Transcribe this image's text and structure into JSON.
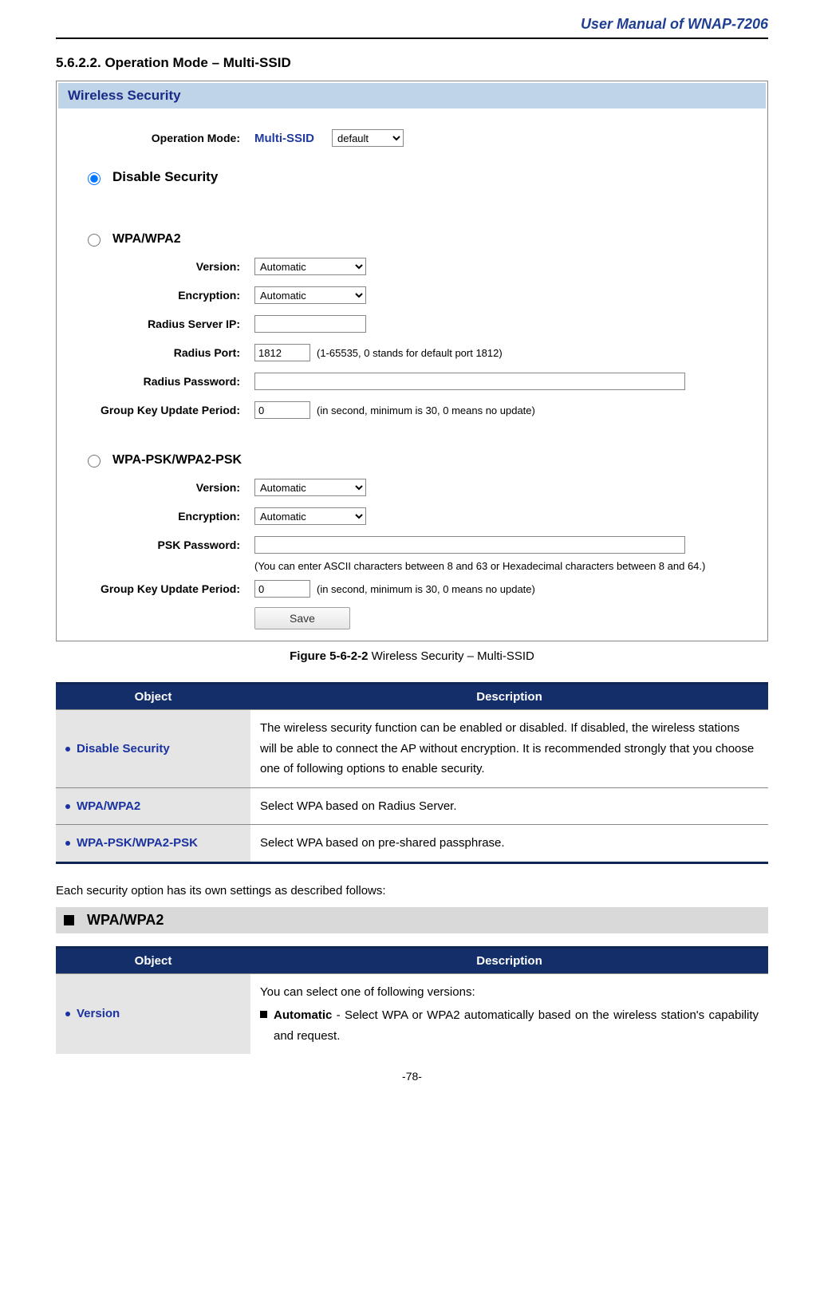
{
  "header": {
    "title": "User Manual of WNAP-7206"
  },
  "section": {
    "number": "5.6.2.2.",
    "title": "Operation Mode – Multi-SSID"
  },
  "panel": {
    "title": "Wireless Security",
    "operationMode": {
      "label": "Operation Mode:",
      "value": "Multi-SSID",
      "select": "default"
    },
    "disable": {
      "title": "Disable Security"
    },
    "wpa": {
      "title": "WPA/WPA2",
      "version": {
        "label": "Version:",
        "value": "Automatic"
      },
      "encryption": {
        "label": "Encryption:",
        "value": "Automatic"
      },
      "radiusIp": {
        "label": "Radius Server IP:",
        "value": ""
      },
      "radiusPort": {
        "label": "Radius Port:",
        "value": "1812",
        "hint": "(1-65535, 0 stands for default port 1812)"
      },
      "radiusPwd": {
        "label": "Radius Password:",
        "value": ""
      },
      "groupKey": {
        "label": "Group Key Update Period:",
        "value": "0",
        "hint": "(in second, minimum is 30, 0 means no update)"
      }
    },
    "psk": {
      "title": "WPA-PSK/WPA2-PSK",
      "version": {
        "label": "Version:",
        "value": "Automatic"
      },
      "encryption": {
        "label": "Encryption:",
        "value": "Automatic"
      },
      "pskPwd": {
        "label": "PSK Password:",
        "value": ""
      },
      "pskNote": "(You can enter ASCII characters between 8 and 63 or Hexadecimal characters between 8 and 64.)",
      "groupKey": {
        "label": "Group Key Update Period:",
        "value": "0",
        "hint": "(in second, minimum is 30, 0 means no update)"
      }
    },
    "saveLabel": "Save"
  },
  "figureCaption": {
    "bold": "Figure 5-6-2-2",
    "rest": " Wireless Security – Multi-SSID"
  },
  "table1": {
    "headObject": "Object",
    "headDesc": "Description",
    "rows": [
      {
        "obj": "Disable Security",
        "desc": "The wireless security function can be enabled or disabled. If disabled, the wireless stations will be able to connect the AP without encryption. It is recommended strongly that you choose one of following options to enable security."
      },
      {
        "obj": "WPA/WPA2",
        "desc": "Select WPA based on Radius Server."
      },
      {
        "obj": "WPA-PSK/WPA2-PSK",
        "desc": "Select WPA based on pre-shared passphrase."
      }
    ]
  },
  "midPara": "Each security option has its own settings as described follows:",
  "subHeading": "WPA/WPA2",
  "table2": {
    "headObject": "Object",
    "headDesc": "Description",
    "row": {
      "obj": "Version",
      "descLine1": "You can select one of following versions:",
      "bulletBold": "Automatic",
      "bulletRest": " - Select WPA or WPA2 automatically based on the wireless station's capability and request."
    }
  },
  "pageNumber": "-78-"
}
